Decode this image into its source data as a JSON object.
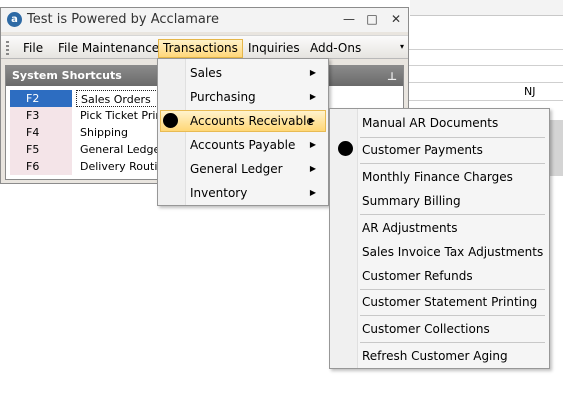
{
  "window": {
    "title": "Test is Powered by Acclamare",
    "logo_letter": "a",
    "minimize": "—",
    "maximize": "□",
    "close": "✕"
  },
  "menubar": {
    "items": [
      "File",
      "File Maintenance",
      "Transactions",
      "Inquiries",
      "Add-Ons"
    ],
    "active": "Transactions",
    "overflow": "▾"
  },
  "shortcuts": {
    "title": "System Shortcuts",
    "pin": "📌",
    "rows": [
      {
        "key": "F2",
        "label": "Sales Orders"
      },
      {
        "key": "F3",
        "label": "Pick Ticket Printi"
      },
      {
        "key": "F4",
        "label": "Shipping"
      },
      {
        "key": "F5",
        "label": "General Ledger"
      },
      {
        "key": "F6",
        "label": "Delivery Routing"
      }
    ]
  },
  "background": {
    "state_value": "NJ"
  },
  "transactions_menu": {
    "items": [
      {
        "label": "Sales",
        "has_submenu": true
      },
      {
        "label": "Purchasing",
        "has_submenu": true
      },
      {
        "label": "Accounts Receivable",
        "has_submenu": true,
        "highlighted": true
      },
      {
        "label": "Accounts Payable",
        "has_submenu": true
      },
      {
        "label": "General Ledger",
        "has_submenu": true
      },
      {
        "label": "Inventory",
        "has_submenu": true
      }
    ],
    "submenu_arrow": "▶"
  },
  "ar_submenu": {
    "items": [
      "Manual AR Documents",
      "Customer Payments",
      "Monthly Finance Charges",
      "Summary Billing",
      "AR Adjustments",
      "Sales Invoice Tax Adjustments",
      "Customer Refunds",
      "Customer Statement Printing",
      "Customer Collections",
      "Refresh Customer Aging"
    ]
  },
  "colors": {
    "highlight": "#ffd776",
    "selection_blue": "#2d6dc1",
    "panel_header": "#7a7a7a"
  }
}
